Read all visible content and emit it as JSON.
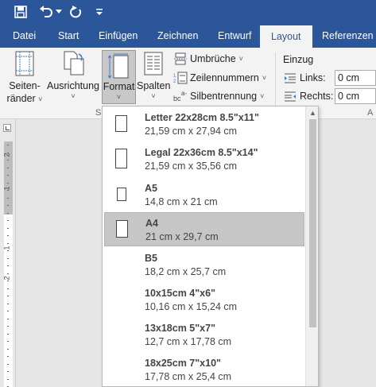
{
  "quick_access": {
    "icons": [
      "save-icon",
      "undo-icon",
      "undo-dropdown-icon",
      "redo-icon",
      "customize-qat-icon"
    ]
  },
  "tabs": [
    {
      "label": "Datei"
    },
    {
      "label": "Start"
    },
    {
      "label": "Einfügen"
    },
    {
      "label": "Zeichnen"
    },
    {
      "label": "Entwurf"
    },
    {
      "label": "Layout",
      "active": true
    },
    {
      "label": "Referenzen"
    }
  ],
  "ribbon": {
    "margins": {
      "line1": "Seiten-",
      "line2": "ränder"
    },
    "orientation": {
      "label": "Ausrichtung"
    },
    "size": {
      "label": "Format"
    },
    "columns": {
      "label": "Spalten"
    },
    "breaks": {
      "label": "Umbrüche"
    },
    "line_numbers": {
      "label": "Zeilennummern"
    },
    "hyphenation": {
      "label": "Silbentrennung"
    },
    "indent": {
      "title": "Einzug",
      "left_label": "Links:",
      "left_value": "0 cm",
      "right_label": "Rechts:",
      "right_value": "0 cm"
    },
    "group_letters": [
      "S",
      "A"
    ]
  },
  "ruler": {
    "numbers": [
      "2",
      "1",
      "1",
      "2"
    ]
  },
  "paper_sizes": [
    {
      "name": "Letter 22x28cm 8.5\"x11\"",
      "dims": "21,59 cm x 27,94 cm"
    },
    {
      "name": "Legal 22x36cm 8.5\"x14\"",
      "dims": "21,59 cm x 35,56 cm"
    },
    {
      "name": "A5",
      "dims": "14,8 cm x 21 cm"
    },
    {
      "name": "A4",
      "dims": "21 cm x 29,7 cm",
      "selected": true
    },
    {
      "name": "B5",
      "dims": "18,2 cm x 25,7 cm"
    },
    {
      "name": "10x15cm 4\"x6\"",
      "dims": "10,16 cm x 15,24 cm"
    },
    {
      "name": "13x18cm 5\"x7\"",
      "dims": "12,7 cm x 17,78 cm"
    },
    {
      "name": "18x25cm 7\"x10\"",
      "dims": "17,78 cm x 25,4 cm"
    }
  ],
  "colors": {
    "accent": "#2b579a",
    "ribbon": "#f3f3f3",
    "selected": "#c6c6c6"
  }
}
